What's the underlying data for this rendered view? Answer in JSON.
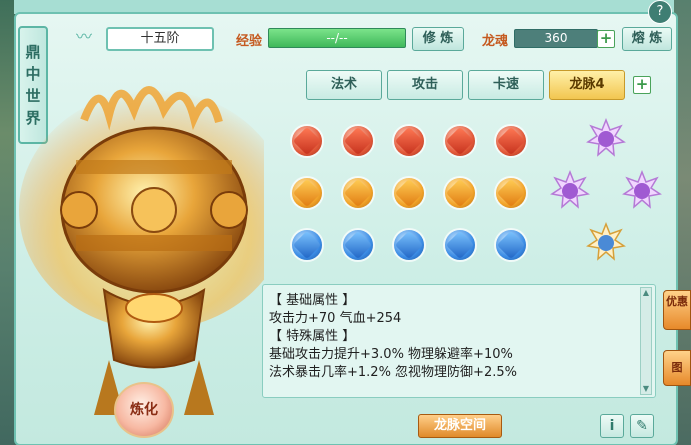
{
  "window": {
    "title_chars": [
      "鼎",
      "中",
      "世",
      "界"
    ],
    "close_label": "?"
  },
  "header": {
    "stage": "十五阶",
    "exp_label": "经验",
    "exp_value": "--/--",
    "cultivate_label": "修 炼",
    "soul_label": "龙魂",
    "soul_value": "360",
    "smelt_label": "熔 炼"
  },
  "tabs": [
    {
      "label": "法术",
      "active": false
    },
    {
      "label": "攻击",
      "active": false
    },
    {
      "label": "卡速",
      "active": false
    },
    {
      "label": "龙脉4",
      "active": true
    }
  ],
  "gems": {
    "rows": [
      [
        "red",
        "red",
        "red",
        "red",
        "red"
      ],
      [
        "orange",
        "orange",
        "orange",
        "orange",
        "orange"
      ],
      [
        "blue",
        "blue",
        "blue",
        "blue",
        "blue"
      ]
    ]
  },
  "attributes": {
    "basic_header": "【 基础属性 】",
    "basic_line": "攻击力+70  气血+254",
    "special_header": "【 特殊属性 】",
    "special_line1": "基础攻击力提升+3.0%  物理躲避率+10%",
    "special_line2": "法术暴击几率+1.2%  忽视物理防御+2.5%"
  },
  "footer": {
    "dragon_space_label": "龙脉空间",
    "info_label": "i",
    "refine_label": "炼化"
  },
  "side": {
    "badge_top": "优惠",
    "badge_mid": "图"
  }
}
